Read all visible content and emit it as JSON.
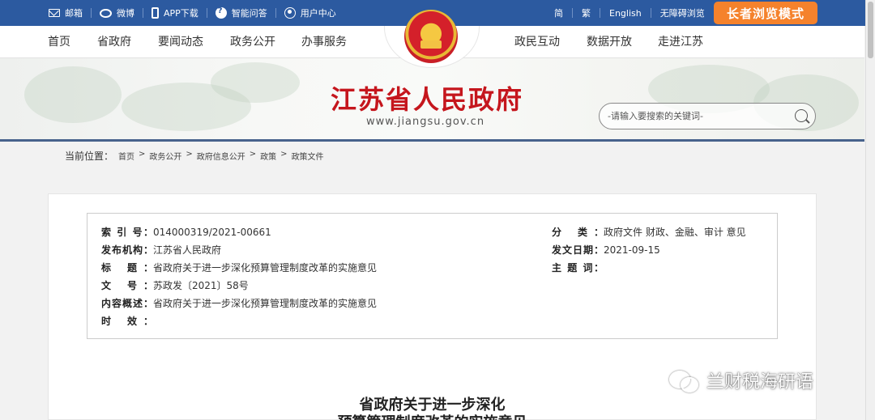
{
  "topbar": {
    "left_items": [
      {
        "label": "邮箱",
        "icon": "mail-icon"
      },
      {
        "label": "微博",
        "icon": "weibo-icon"
      },
      {
        "label": "APP下载",
        "icon": "phone-icon"
      },
      {
        "label": "智能问答",
        "icon": "qa-icon"
      },
      {
        "label": "用户中心",
        "icon": "user-icon"
      }
    ],
    "right_items": [
      "简",
      "繁",
      "English",
      "无障碍浏览"
    ],
    "elder_mode": "长者浏览模式",
    "colors": {
      "bar": "#2c5aa0",
      "elder": "#f5822c"
    }
  },
  "nav": {
    "left": [
      "首页",
      "省政府",
      "要闻动态",
      "政务公开",
      "办事服务"
    ],
    "right": [
      "政民互动",
      "数据开放",
      "走进江苏"
    ]
  },
  "header": {
    "title": "江苏省人民政府",
    "url": "www.jiangsu.gov.cn",
    "search_placeholder": "-请输入要搜索的关键词-",
    "title_color": "#c5161d"
  },
  "breadcrumb": {
    "label": "当前位置：",
    "path": [
      "首页",
      "政务公开",
      "政府信息公开",
      "政策",
      "政策文件"
    ]
  },
  "meta": {
    "index_label": "索 引 号：",
    "index": "014000319/2021-00661",
    "issuer_label": "发布机构：",
    "issuer": "江苏省人民政府",
    "title_label": "标 题：",
    "title": "省政府关于进一步深化预算管理制度改革的实施意见",
    "docno_label": "文 号：",
    "docno": "苏政发〔2021〕58号",
    "summary_label": "内容概述：",
    "summary": "省政府关于进一步深化预算管理制度改革的实施意见",
    "validity_label": "时 效：",
    "validity": "",
    "category_label": "分 类：",
    "category": "政府文件 财政、金融、审计 意见",
    "date_label": "发文日期：",
    "date": "2021-09-15",
    "subject_label": "主 题 词：",
    "subject": ""
  },
  "document": {
    "title_line1": "省政府关于进一步深化",
    "title_line2": "预算管理制度改革的实施意见"
  },
  "watermark": "兰财税海研语"
}
